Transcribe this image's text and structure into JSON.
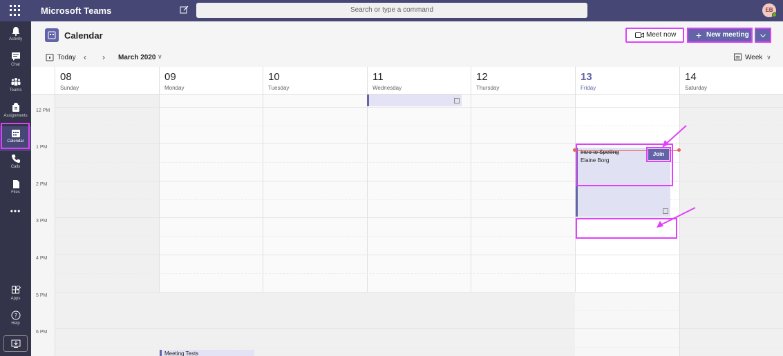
{
  "topbar": {
    "app_title": "Microsoft Teams",
    "search_placeholder": "Search or type a command",
    "avatar_initials": "EB"
  },
  "rail": {
    "items": [
      {
        "label": "Activity",
        "icon": "bell-icon"
      },
      {
        "label": "Chat",
        "icon": "chat-icon"
      },
      {
        "label": "Teams",
        "icon": "teams-icon"
      },
      {
        "label": "Assignments",
        "icon": "assignments-icon"
      },
      {
        "label": "Calendar",
        "icon": "calendar-icon",
        "active": true
      },
      {
        "label": "Calls",
        "icon": "phone-icon"
      },
      {
        "label": "Files",
        "icon": "file-icon"
      }
    ],
    "more": "•••",
    "bottom": [
      {
        "label": "Apps",
        "icon": "apps-icon"
      },
      {
        "label": "Help",
        "icon": "help-icon"
      }
    ]
  },
  "header": {
    "title": "Calendar",
    "meet_now": "Meet now",
    "new_meeting": "New meeting"
  },
  "toolbar": {
    "today": "Today",
    "month": "March 2020",
    "view": "Week"
  },
  "days": [
    {
      "num": "08",
      "name": "Sunday"
    },
    {
      "num": "09",
      "name": "Monday"
    },
    {
      "num": "10",
      "name": "Tuesday"
    },
    {
      "num": "11",
      "name": "Wednesday"
    },
    {
      "num": "12",
      "name": "Thursday"
    },
    {
      "num": "13",
      "name": "Friday",
      "today": true
    },
    {
      "num": "14",
      "name": "Saturday"
    }
  ],
  "times": [
    "12 PM",
    "1 PM",
    "2 PM",
    "3 PM",
    "4 PM",
    "5 PM",
    "6 PM"
  ],
  "events": {
    "friday_title": "Intro to Spelling",
    "friday_host": "Elaine Borg",
    "join": "Join",
    "monday_title": "Meeting Tests"
  },
  "colors": {
    "brand": "#6264a7",
    "topbar": "#464775",
    "rail": "#33344a",
    "highlight": "#e040fb",
    "now_line": "#e8624f"
  }
}
